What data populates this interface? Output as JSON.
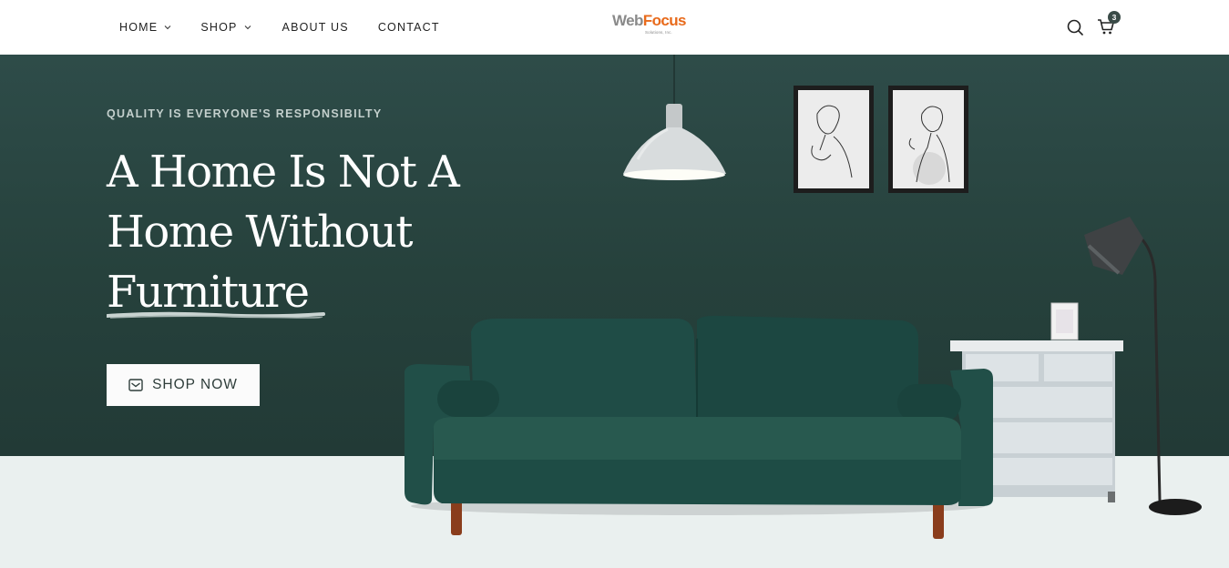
{
  "header": {
    "nav": [
      {
        "label": "HOME",
        "dropdown": true
      },
      {
        "label": "SHOP",
        "dropdown": true
      },
      {
        "label": "ABOUT US",
        "dropdown": false
      },
      {
        "label": "CONTACT",
        "dropdown": false
      }
    ],
    "logo": {
      "part1": "Web",
      "part2": "Focus",
      "tagline": "Solutions, Inc."
    },
    "icons": {
      "search": "search-icon",
      "cart": "cart-icon"
    },
    "cart_count": "3"
  },
  "hero": {
    "eyebrow": "QUALITY IS EVERYONE'S RESPONSIBILTY",
    "headline": [
      "A Home Is Not A",
      "Home Without",
      "Furniture"
    ],
    "cta_label": "SHOP NOW",
    "cta_icon": "envelope-icon"
  },
  "colors": {
    "hero_bg": "#2b4744",
    "floor_bg": "#eaf0ef",
    "sofa": "#1f4d47",
    "logo_orange": "#e86a1b"
  }
}
